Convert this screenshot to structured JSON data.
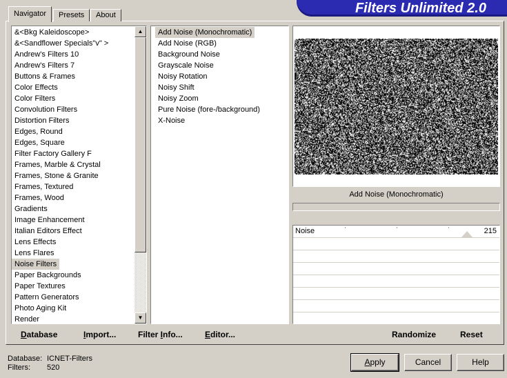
{
  "tabs": [
    {
      "label": "Navigator",
      "active": true
    },
    {
      "label": "Presets",
      "active": false
    },
    {
      "label": "About",
      "active": false
    }
  ],
  "banner": "Filters Unlimited 2.0",
  "categories": {
    "items": [
      "&<Bkg Kaleidoscope>",
      "&<Sandflower Specials\"v\" >",
      "Andrew's Filters 10",
      "Andrew's Filters 7",
      "Buttons & Frames",
      "Color Effects",
      "Color Filters",
      "Convolution Filters",
      "Distortion Filters",
      "Edges, Round",
      "Edges, Square",
      "Filter Factory Gallery F",
      "Frames, Marble & Crystal",
      "Frames, Stone & Granite",
      "Frames, Textured",
      "Frames, Wood",
      "Gradients",
      "Image Enhancement",
      "Italian Editors Effect",
      "Lens Effects",
      "Lens Flares",
      "Noise Filters",
      "Paper Backgrounds",
      "Paper Textures",
      "Pattern Generators",
      "Photo Aging Kit",
      "Render"
    ],
    "selected": "Noise Filters"
  },
  "filters": {
    "items": [
      "Add Noise (Monochromatic)",
      "Add Noise (RGB)",
      "Background Noise",
      "Grayscale Noise",
      "Noisy Rotation",
      "Noisy Shift",
      "Noisy Zoom",
      "Pure Noise (fore-/background)",
      "X-Noise"
    ],
    "selected": "Add Noise (Monochromatic)"
  },
  "preview": {
    "filter_name": "Add Noise (Monochromatic)"
  },
  "sliders": [
    {
      "label": "Noise",
      "value": "215",
      "fraction": 0.843
    }
  ],
  "toolbar": {
    "database": {
      "mnemonic": "D",
      "rest": "atabase"
    },
    "import": {
      "mnemonic": "I",
      "rest": "mport..."
    },
    "filter_info": {
      "before": "Filter ",
      "mnemonic": "I",
      "after": "nfo..."
    },
    "editor": {
      "mnemonic": "E",
      "rest": "ditor..."
    },
    "randomize": "Randomize",
    "reset": "Reset"
  },
  "status": {
    "database_label": "Database:",
    "database_value": "ICNET-Filters",
    "filters_label": "Filters:",
    "filters_value": "520"
  },
  "buttons": {
    "apply": {
      "mnemonic": "A",
      "rest": "pply"
    },
    "cancel": "Cancel",
    "help": "Help"
  }
}
